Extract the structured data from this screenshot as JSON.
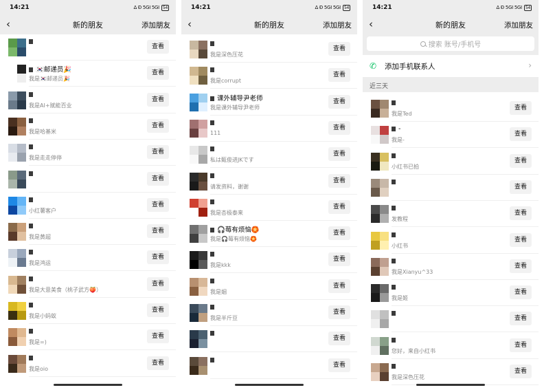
{
  "panels": [
    {
      "status": {
        "time": "14:21",
        "signal": "Δ Đ 5GI 5GI",
        "battery": "54"
      },
      "nav": {
        "title": "新的朋友",
        "add": "添加朋友"
      },
      "items": [
        {
          "name": "",
          "msg": "",
          "button": "查看",
          "colors": [
            "#5a9a4a",
            "#3c6e8a",
            "#7bb86a",
            "#2a4c6a"
          ]
        },
        {
          "name": "🇰🇷邮递员🎉",
          "msg": "我是🇰🇷邮递员🎉",
          "button": "查看",
          "colors": [
            "#ffffff",
            "#222222",
            "#ffffff",
            "#eeeeee"
          ]
        },
        {
          "name": "",
          "msg": "我是AI+赋能百业",
          "button": "查看",
          "colors": [
            "#8a9aaa",
            "#3d4d5d",
            "#6a7a8a",
            "#2a3a4a"
          ]
        },
        {
          "name": "",
          "msg": "我是哈基米",
          "button": "查看",
          "colors": [
            "#4a3020",
            "#8a6040",
            "#2a1a10",
            "#b08060"
          ]
        },
        {
          "name": "",
          "msg": "我是走走停停",
          "button": "查看",
          "colors": [
            "#d8dde5",
            "#b5bcc8",
            "#e8ebf0",
            "#9aa2ae"
          ]
        },
        {
          "name": "",
          "msg": "",
          "button": "查看",
          "colors": [
            "#8a9a8a",
            "#5a6a7a",
            "#aab5aa",
            "#3a4a5a"
          ]
        },
        {
          "name": "",
          "msg": "小红薯客户",
          "button": "查看",
          "colors": [
            "#1e88e5",
            "#64b5f6",
            "#0d47a1",
            "#90caf9"
          ]
        },
        {
          "name": "",
          "msg": "我是黄超",
          "button": "查看",
          "colors": [
            "#8a6a4a",
            "#caa07a",
            "#5a3a2a",
            "#e0c0a0"
          ]
        },
        {
          "name": "",
          "msg": "我是鸿运",
          "button": "查看",
          "colors": [
            "#c8d0dc",
            "#9aa8bc",
            "#eef2f6",
            "#6a7a90"
          ]
        },
        {
          "name": "",
          "msg": "我是大意美食（桃子武方🍑）",
          "button": "查看",
          "colors": [
            "#d8b890",
            "#a08060",
            "#f0d8b8",
            "#705038"
          ]
        },
        {
          "name": "",
          "msg": "我是小蚂蚁",
          "button": "查看",
          "colors": [
            "#d8b820",
            "#f0d040",
            "#3a3010",
            "#b89a10"
          ]
        },
        {
          "name": "",
          "msg": "我是=)",
          "button": "查看",
          "colors": [
            "#c08a60",
            "#e0b890",
            "#8a5a3a",
            "#f0d0b0"
          ]
        },
        {
          "name": "",
          "msg": "我是oio",
          "button": "查看",
          "colors": [
            "#6a4a3a",
            "#a07a5a",
            "#3a2a1a",
            "#c09a7a"
          ]
        }
      ]
    },
    {
      "status": {
        "time": "14:21",
        "signal": "Δ Đ 5GI 5GI",
        "battery": "54"
      },
      "nav": {
        "title": "新的朋友",
        "add": "添加朋友"
      },
      "items": [
        {
          "name": "",
          "msg": "我是深色压花",
          "button": "查看",
          "colors": [
            "#c8b8a0",
            "#8a7060",
            "#e8d8c0",
            "#5a4a3a"
          ]
        },
        {
          "name": "",
          "msg": "我是corrupt",
          "button": "查看",
          "colors": [
            "#d0b890",
            "#a08a60",
            "#f0e0c0",
            "#706040"
          ]
        },
        {
          "name": "课外辅导尹老师",
          "msg": "我是课外辅导尹老师",
          "button": "查看",
          "colors": [
            "#4aa0e0",
            "#a0d0f0",
            "#2070b0",
            "#e0f0ff"
          ]
        },
        {
          "name": "",
          "msg": "111",
          "button": "查看",
          "colors": [
            "#a07070",
            "#d0a0a0",
            "#6a4040",
            "#e8c8c8"
          ]
        },
        {
          "name": "",
          "msg": "私は甄俊进JKです",
          "button": "查看",
          "colors": [
            "#e8e8e8",
            "#c8c8c8",
            "#f8f8f8",
            "#a8a8a8"
          ]
        },
        {
          "name": "",
          "msg": "请发资料，谢谢",
          "button": "查看",
          "colors": [
            "#2a2a2a",
            "#4a3a2a",
            "#1a1a1a",
            "#6a5040"
          ]
        },
        {
          "name": "",
          "msg": "我是杏极泰来",
          "button": "查看",
          "colors": [
            "#d04030",
            "#f0a090",
            "#ffffff",
            "#a02010"
          ]
        },
        {
          "name": "🎧莓有烦恼🏵️",
          "msg": "我是🎧莓有烦恼🏵️",
          "button": "查看",
          "colors": [
            "#707070",
            "#a0a0a0",
            "#404040",
            "#c8c8c8"
          ]
        },
        {
          "name": "",
          "msg": "我是kkk",
          "button": "查看",
          "colors": [
            "#1a1a1a",
            "#3a3a3a",
            "#000000",
            "#5a5a5a"
          ]
        },
        {
          "name": "",
          "msg": "我是姻",
          "button": "查看",
          "colors": [
            "#b89070",
            "#d8b898",
            "#8a6040",
            "#f0d8c0"
          ]
        },
        {
          "name": "",
          "msg": "我是半斤豆",
          "button": "查看",
          "colors": [
            "#3a4a5a",
            "#6a7a8a",
            "#1a2a3a",
            "#c0a080"
          ]
        },
        {
          "name": "",
          "msg": "",
          "button": "查看",
          "colors": [
            "#2a3a4a",
            "#4a6070",
            "#1a2030",
            "#7a90a0"
          ]
        },
        {
          "name": "",
          "msg": "",
          "button": "查看",
          "colors": [
            "#5a4a3a",
            "#8a7060",
            "#3a2a1a",
            "#a89070"
          ]
        }
      ]
    },
    {
      "status": {
        "time": "14:21",
        "signal": "Δ Đ 5GI 5GI",
        "battery": "54"
      },
      "nav": {
        "title": "新的朋友",
        "add": "添加朋友"
      },
      "search": {
        "placeholder": "搜索 账号/手机号"
      },
      "phone": {
        "label": "添加手机联系人"
      },
      "section": {
        "label": "近三天"
      },
      "items": [
        {
          "name": "",
          "msg": "我是Ted",
          "button": "查看",
          "colors": [
            "#6a5040",
            "#a08870",
            "#3a2a20",
            "#c8b098"
          ]
        },
        {
          "name": "-",
          "msg": "我是-",
          "button": "查看",
          "colors": [
            "#e8e0e0",
            "#c04040",
            "#f8f8f8",
            "#d0c8c8"
          ]
        },
        {
          "name": "",
          "msg": "小红书已拍",
          "button": "查看",
          "colors": [
            "#3a3020",
            "#d8c060",
            "#1a1a10",
            "#f0e8c0"
          ]
        },
        {
          "name": "",
          "msg": "",
          "button": "查看",
          "colors": [
            "#9a8a7a",
            "#c8b8a8",
            "#6a5a4a",
            "#e0d0c0"
          ]
        },
        {
          "name": "",
          "msg": "发教程",
          "button": "查看",
          "colors": [
            "#4a4a4a",
            "#8a8a8a",
            "#2a2a2a",
            "#b0b0b0"
          ]
        },
        {
          "name": "",
          "msg": "小红书",
          "button": "查看",
          "colors": [
            "#e8c840",
            "#f8e080",
            "#c0a020",
            "#fff0b0"
          ]
        },
        {
          "name": "",
          "msg": "我是Xianyu^33",
          "button": "查看",
          "colors": [
            "#8a6a5a",
            "#c0a090",
            "#5a4030",
            "#e0c8b8"
          ]
        },
        {
          "name": "",
          "msg": "我是姬",
          "button": "查看",
          "colors": [
            "#2a2a2a",
            "#6a6a6a",
            "#1a1a1a",
            "#9a9a9a"
          ]
        },
        {
          "name": "",
          "msg": "",
          "button": "查看",
          "colors": [
            "#e0e0e0",
            "#c0c0c0",
            "#f0f0f0",
            "#a8a8a8"
          ]
        },
        {
          "name": "",
          "msg": "您好，来自小红书",
          "button": "查看",
          "colors": [
            "#d0d8d0",
            "#88a088",
            "#f0f0f0",
            "#607060"
          ]
        },
        {
          "name": "",
          "msg": "我是深色压花",
          "button": "查看",
          "colors": [
            "#c8a890",
            "#8a6a50",
            "#e8d0c0",
            "#5a4030"
          ]
        }
      ]
    }
  ]
}
